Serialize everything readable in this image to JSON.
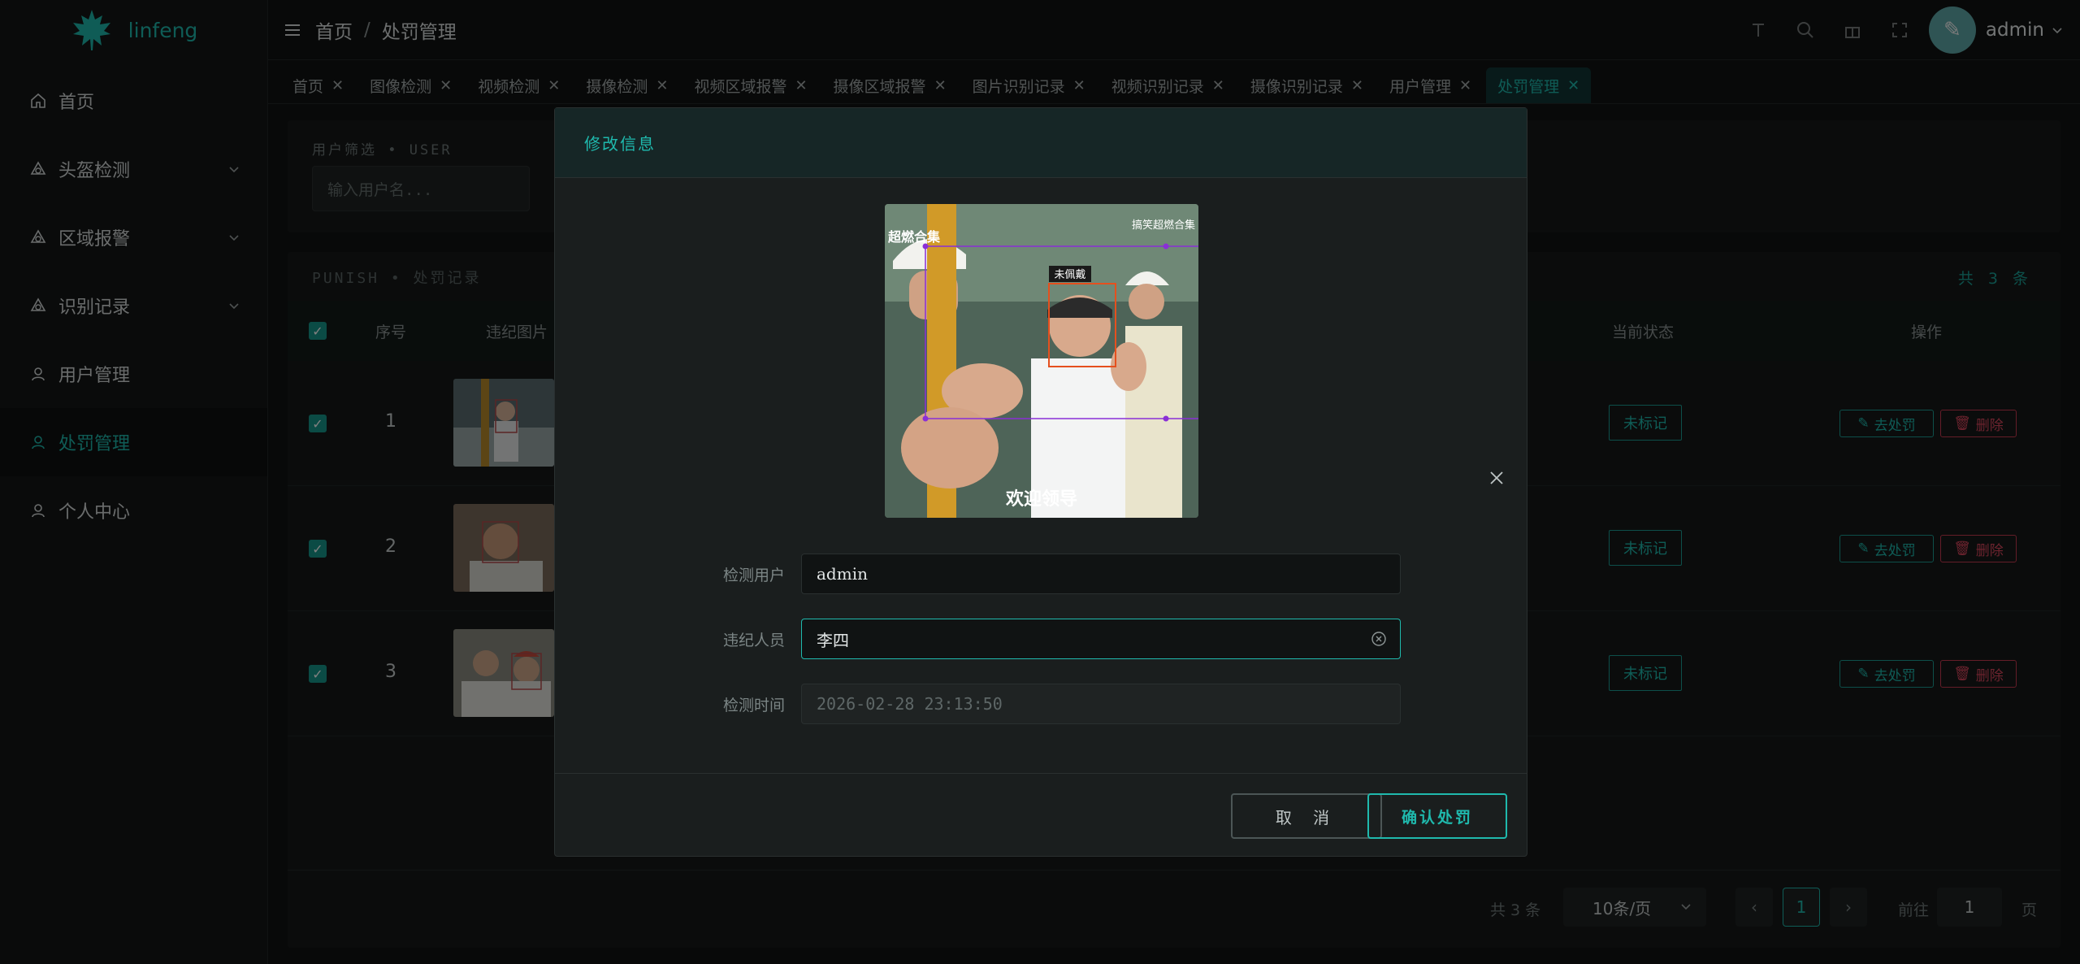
{
  "app": {
    "brand": "linfeng"
  },
  "sidebar": {
    "items": [
      {
        "label": "首页",
        "icon": "home-icon",
        "expandable": false
      },
      {
        "label": "头盔检测",
        "icon": "helmet-icon",
        "expandable": true
      },
      {
        "label": "区域报警",
        "icon": "alarm-icon",
        "expandable": true
      },
      {
        "label": "识别记录",
        "icon": "records-icon",
        "expandable": true
      },
      {
        "label": "用户管理",
        "icon": "user-icon",
        "expandable": false
      },
      {
        "label": "处罚管理",
        "icon": "user-icon",
        "expandable": false,
        "active": true
      },
      {
        "label": "个人中心",
        "icon": "profile-icon",
        "expandable": false
      }
    ]
  },
  "header": {
    "breadcrumb": [
      "首页",
      "处罚管理"
    ],
    "user_name": "admin"
  },
  "tabs": [
    {
      "label": "首页"
    },
    {
      "label": "图像检测"
    },
    {
      "label": "视频检测"
    },
    {
      "label": "摄像检测"
    },
    {
      "label": "视频区域报警"
    },
    {
      "label": "摄像区域报警"
    },
    {
      "label": "图片识别记录"
    },
    {
      "label": "视频识别记录"
    },
    {
      "label": "摄像识别记录"
    },
    {
      "label": "用户管理"
    },
    {
      "label": "处罚管理",
      "active": true
    }
  ],
  "filter": {
    "label": "用户筛选 • USER",
    "placeholder": "输入用户名..."
  },
  "table": {
    "heading": "PUNISH • 处罚记录",
    "total": "共 3 条",
    "columns": {
      "index": "序号",
      "image": "违纪图片",
      "status": "当前状态",
      "actions": "操作"
    },
    "rows": [
      {
        "index": "1",
        "status": "未标记",
        "checked": true
      },
      {
        "index": "2",
        "status": "未标记",
        "checked": true
      },
      {
        "index": "3",
        "status": "未标记",
        "checked": true
      }
    ],
    "punish_label": "去处罚",
    "delete_label": "删除"
  },
  "pagination": {
    "total": "共 3 条",
    "page_size": "10条/页",
    "current_page": "1",
    "goto_label": "前往",
    "goto_value": "1",
    "page_suffix": "页"
  },
  "modal": {
    "title": "修改信息",
    "image_overlay": {
      "top_left": "超燃合集",
      "top_right": "搞笑超燃合集",
      "box_label": "未佩戴",
      "caption": "欢迎领导"
    },
    "fields": [
      {
        "label": "检测用户",
        "value": "admin"
      },
      {
        "label": "违纪人员",
        "value": "李四"
      },
      {
        "label": "检测时间",
        "value": "2026-02-28 23:13:50"
      }
    ],
    "cancel_label": "取 消",
    "confirm_label": "确认处罚"
  },
  "colors": {
    "accent": "#1fb9ad",
    "danger": "#d9475d",
    "background": "#111313"
  }
}
